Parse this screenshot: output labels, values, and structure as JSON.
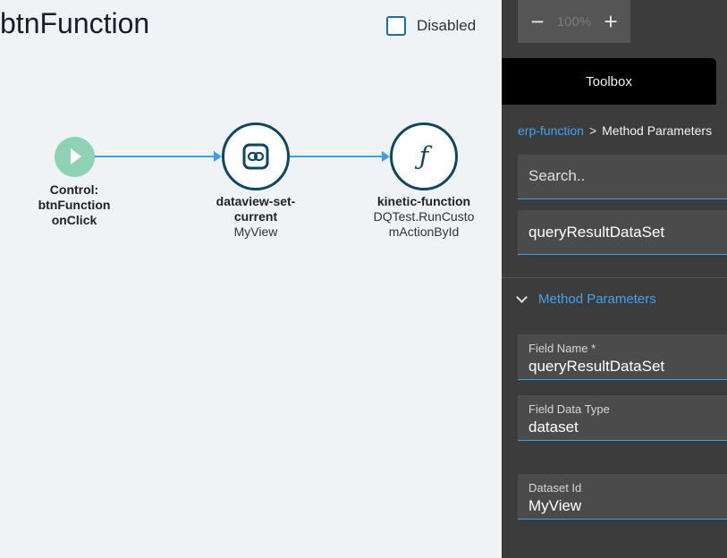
{
  "canvas": {
    "title": "btnFunction",
    "disabled_label": "Disabled",
    "nodes": [
      {
        "type": "Control:",
        "name": "btnFunction",
        "sub": "onClick"
      },
      {
        "type": "dataview-set-",
        "name": "current",
        "sub": "MyView"
      },
      {
        "type": "kinetic-function",
        "sub_line1": "DQTest.RunCusto",
        "sub_line2": "mActionById"
      }
    ]
  },
  "panel": {
    "zoom": {
      "minus": "−",
      "value": "100%",
      "plus": "+"
    },
    "toolbox_label": "Toolbox",
    "breadcrumb": {
      "link": "erp-function",
      "separator": ">",
      "current": "Method Parameters"
    },
    "search_placeholder": "Search..",
    "selected_field": "queryResultDataSet",
    "section_title": "Method Parameters",
    "params": [
      {
        "label": "Field Name *",
        "value": "queryResultDataSet"
      },
      {
        "label": "Field Data Type",
        "value": "dataset"
      },
      {
        "label": "Dataset Id",
        "value": "MyView"
      }
    ]
  },
  "colors": {
    "accent": "#3a9ff0",
    "node_border": "#0f4760",
    "start_node": "#8dd3b4",
    "panel_bg": "#3c3c3c"
  }
}
